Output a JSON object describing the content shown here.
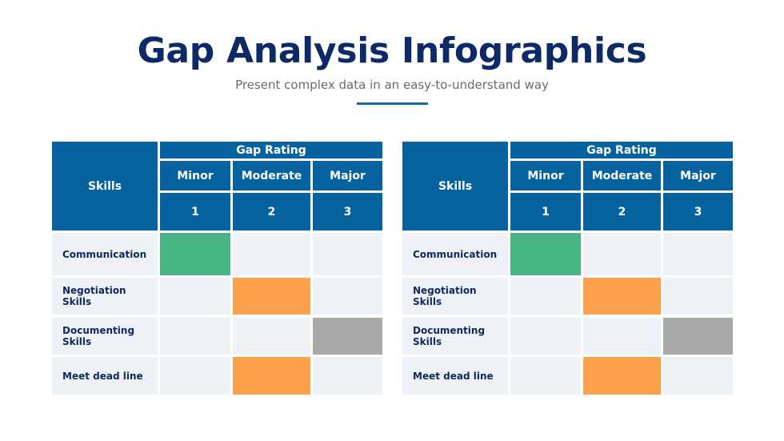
{
  "header": {
    "title": "Gap Analysis Infographics",
    "subtitle": "Present complex data in an easy-to-understand way"
  },
  "colors": {
    "header_fill": "#07639f",
    "empty_cell": "#eef1f5",
    "minor": "#47b483",
    "moderate": "#fda04c",
    "major": "#a9a9a9",
    "title": "#0e2a66"
  },
  "tables": [
    {
      "skills_header": "Skills",
      "group_header": "Gap Rating",
      "columns": [
        {
          "label": "Minor",
          "number": "1"
        },
        {
          "label": "Moderate",
          "number": "2"
        },
        {
          "label": "Major",
          "number": "3"
        }
      ],
      "rows": [
        {
          "skill": "Communication",
          "rating": 1
        },
        {
          "skill": "Negotiation Skills",
          "rating": 2
        },
        {
          "skill": "Documenting Skills",
          "rating": 3
        },
        {
          "skill": "Meet dead line",
          "rating": 2
        }
      ]
    },
    {
      "skills_header": "Skills",
      "group_header": "Gap Rating",
      "columns": [
        {
          "label": "Minor",
          "number": "1"
        },
        {
          "label": "Moderate",
          "number": "2"
        },
        {
          "label": "Major",
          "number": "3"
        }
      ],
      "rows": [
        {
          "skill": "Communication",
          "rating": 1
        },
        {
          "skill": "Negotiation Skills",
          "rating": 2
        },
        {
          "skill": "Documenting Skills",
          "rating": 3
        },
        {
          "skill": "Meet dead line",
          "rating": 2
        }
      ]
    }
  ]
}
